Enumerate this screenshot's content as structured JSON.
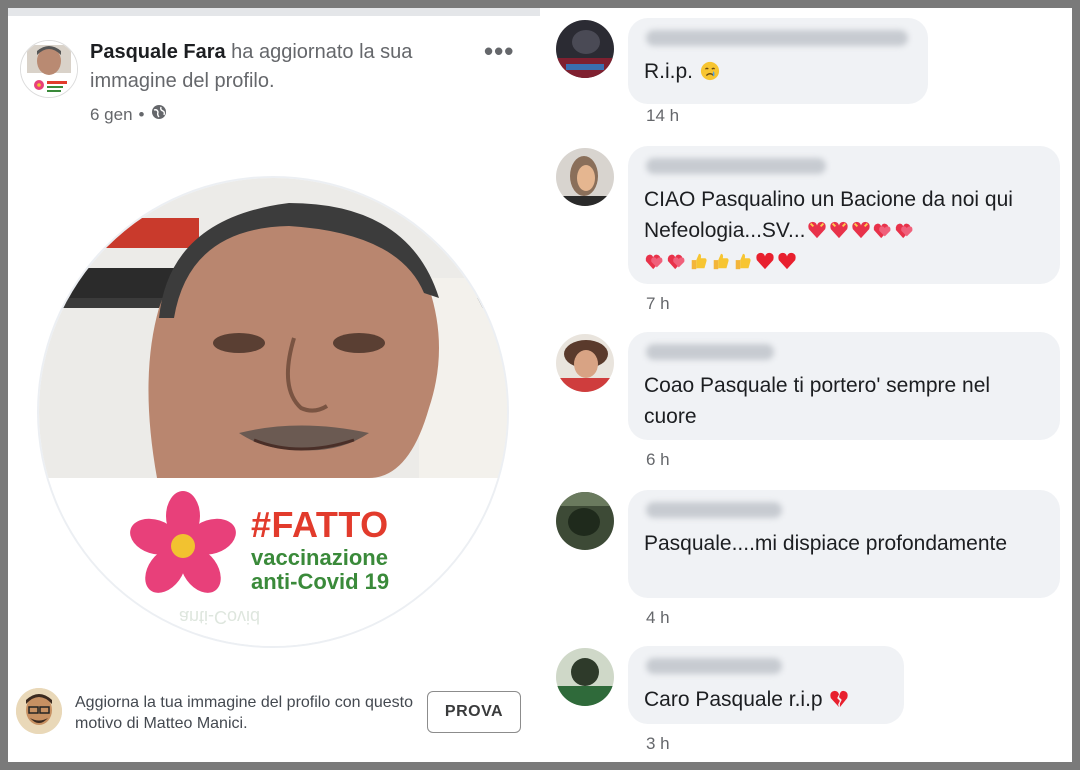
{
  "post": {
    "author": "Pasquale Fara",
    "action": " ha aggiornato la sua immagine del profilo.",
    "date": "6 gen",
    "separator": "•",
    "frame": {
      "hashtag": "#FATTO",
      "line1": "vaccinazione",
      "line2": "anti-Covid 19"
    },
    "cta": {
      "text": "Aggiorna la tua immagine del profilo con questo motivo di Matteo Manici.",
      "button": "PROVA"
    }
  },
  "comments": [
    {
      "text": "R.i.p.",
      "time": "14 h",
      "emoji": "crying-face"
    },
    {
      "text": "CIAO Pasqualino un Bacione da noi qui Nefeologia...SV...",
      "time": "7 h",
      "emoji": "hearts-and-thumbs"
    },
    {
      "text": "Coao Pasquale ti portero' sempre nel cuore",
      "time": "6 h"
    },
    {
      "text": "Pasquale....mi dispiace profondamente",
      "time": "4 h"
    },
    {
      "text": "Caro Pasquale r.i.p",
      "time": "3 h",
      "emoji": "broken-heart"
    }
  ],
  "colors": {
    "fatto_red": "#e23b2c",
    "vacc_green": "#3a8a3a",
    "flower_pink": "#e8407a",
    "bubble": "#f0f2f5"
  }
}
